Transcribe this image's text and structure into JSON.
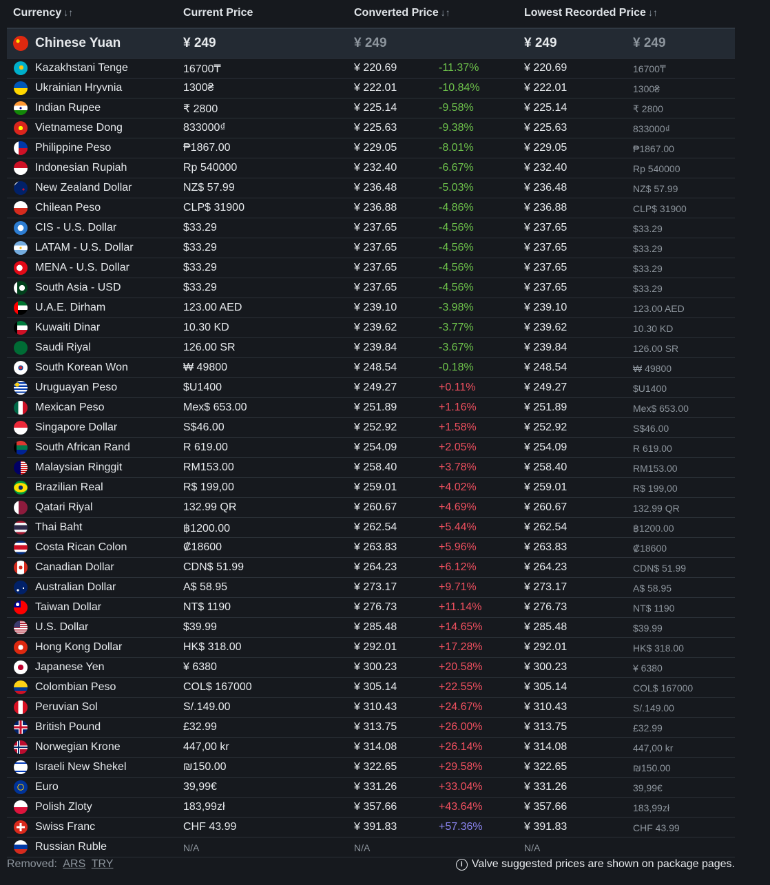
{
  "header": {
    "currency": "Currency",
    "current_price": "Current Price",
    "converted_price": "Converted Price",
    "lowest_price": "Lowest Recorded Price",
    "sort_glyph": "↓↑"
  },
  "base": {
    "name": "Chinese Yuan",
    "current": "¥ 249",
    "converted": "¥ 249",
    "lowest": "¥ 249",
    "lowest_local": "¥ 249",
    "flag": "cn"
  },
  "rows": [
    {
      "name": "Kazakhstani Tenge",
      "current": "16700₸",
      "converted": "¥ 220.69",
      "pct": "-11.37%",
      "lowest": "¥ 220.69",
      "lowest_local": "16700₸",
      "flag": "kz"
    },
    {
      "name": "Ukrainian Hryvnia",
      "current": "1300₴",
      "converted": "¥ 222.01",
      "pct": "-10.84%",
      "lowest": "¥ 222.01",
      "lowest_local": "1300₴",
      "flag": "ua"
    },
    {
      "name": "Indian Rupee",
      "current": "₹ 2800",
      "converted": "¥ 225.14",
      "pct": "-9.58%",
      "lowest": "¥ 225.14",
      "lowest_local": "₹ 2800",
      "flag": "in"
    },
    {
      "name": "Vietnamese Dong",
      "current": "833000₫",
      "converted": "¥ 225.63",
      "pct": "-9.38%",
      "lowest": "¥ 225.63",
      "lowest_local": "833000₫",
      "flag": "vn"
    },
    {
      "name": "Philippine Peso",
      "current": "₱1867.00",
      "converted": "¥ 229.05",
      "pct": "-8.01%",
      "lowest": "¥ 229.05",
      "lowest_local": "₱1867.00",
      "flag": "ph"
    },
    {
      "name": "Indonesian Rupiah",
      "current": "Rp 540000",
      "converted": "¥ 232.40",
      "pct": "-6.67%",
      "lowest": "¥ 232.40",
      "lowest_local": "Rp 540000",
      "flag": "id"
    },
    {
      "name": "New Zealand Dollar",
      "current": "NZ$ 57.99",
      "converted": "¥ 236.48",
      "pct": "-5.03%",
      "lowest": "¥ 236.48",
      "lowest_local": "NZ$ 57.99",
      "flag": "nz"
    },
    {
      "name": "Chilean Peso",
      "current": "CLP$ 31900",
      "converted": "¥ 236.88",
      "pct": "-4.86%",
      "lowest": "¥ 236.88",
      "lowest_local": "CLP$ 31900",
      "flag": "cl"
    },
    {
      "name": "CIS - U.S. Dollar",
      "current": "$33.29",
      "converted": "¥ 237.65",
      "pct": "-4.56%",
      "lowest": "¥ 237.65",
      "lowest_local": "$33.29",
      "flag": "cis"
    },
    {
      "name": "LATAM - U.S. Dollar",
      "current": "$33.29",
      "converted": "¥ 237.65",
      "pct": "-4.56%",
      "lowest": "¥ 237.65",
      "lowest_local": "$33.29",
      "flag": "ar"
    },
    {
      "name": "MENA - U.S. Dollar",
      "current": "$33.29",
      "converted": "¥ 237.65",
      "pct": "-4.56%",
      "lowest": "¥ 237.65",
      "lowest_local": "$33.29",
      "flag": "tr"
    },
    {
      "name": "South Asia - USD",
      "current": "$33.29",
      "converted": "¥ 237.65",
      "pct": "-4.56%",
      "lowest": "¥ 237.65",
      "lowest_local": "$33.29",
      "flag": "pk"
    },
    {
      "name": "U.A.E. Dirham",
      "current": "123.00 AED",
      "converted": "¥ 239.10",
      "pct": "-3.98%",
      "lowest": "¥ 239.10",
      "lowest_local": "123.00 AED",
      "flag": "ae"
    },
    {
      "name": "Kuwaiti Dinar",
      "current": "10.30 KD",
      "converted": "¥ 239.62",
      "pct": "-3.77%",
      "lowest": "¥ 239.62",
      "lowest_local": "10.30 KD",
      "flag": "kw"
    },
    {
      "name": "Saudi Riyal",
      "current": "126.00 SR",
      "converted": "¥ 239.84",
      "pct": "-3.67%",
      "lowest": "¥ 239.84",
      "lowest_local": "126.00 SR",
      "flag": "sa"
    },
    {
      "name": "South Korean Won",
      "current": "₩ 49800",
      "converted": "¥ 248.54",
      "pct": "-0.18%",
      "lowest": "¥ 248.54",
      "lowest_local": "₩ 49800",
      "flag": "kr"
    },
    {
      "name": "Uruguayan Peso",
      "current": "$U1400",
      "converted": "¥ 249.27",
      "pct": "+0.11%",
      "lowest": "¥ 249.27",
      "lowest_local": "$U1400",
      "flag": "uy"
    },
    {
      "name": "Mexican Peso",
      "current": "Mex$ 653.00",
      "converted": "¥ 251.89",
      "pct": "+1.16%",
      "lowest": "¥ 251.89",
      "lowest_local": "Mex$ 653.00",
      "flag": "mx"
    },
    {
      "name": "Singapore Dollar",
      "current": "S$46.00",
      "converted": "¥ 252.92",
      "pct": "+1.58%",
      "lowest": "¥ 252.92",
      "lowest_local": "S$46.00",
      "flag": "sg"
    },
    {
      "name": "South African Rand",
      "current": "R 619.00",
      "converted": "¥ 254.09",
      "pct": "+2.05%",
      "lowest": "¥ 254.09",
      "lowest_local": "R 619.00",
      "flag": "za"
    },
    {
      "name": "Malaysian Ringgit",
      "current": "RM153.00",
      "converted": "¥ 258.40",
      "pct": "+3.78%",
      "lowest": "¥ 258.40",
      "lowest_local": "RM153.00",
      "flag": "my"
    },
    {
      "name": "Brazilian Real",
      "current": "R$ 199,00",
      "converted": "¥ 259.01",
      "pct": "+4.02%",
      "lowest": "¥ 259.01",
      "lowest_local": "R$ 199,00",
      "flag": "br"
    },
    {
      "name": "Qatari Riyal",
      "current": "132.99 QR",
      "converted": "¥ 260.67",
      "pct": "+4.69%",
      "lowest": "¥ 260.67",
      "lowest_local": "132.99 QR",
      "flag": "qa"
    },
    {
      "name": "Thai Baht",
      "current": "฿1200.00",
      "converted": "¥ 262.54",
      "pct": "+5.44%",
      "lowest": "¥ 262.54",
      "lowest_local": "฿1200.00",
      "flag": "th"
    },
    {
      "name": "Costa Rican Colon",
      "current": "₡18600",
      "converted": "¥ 263.83",
      "pct": "+5.96%",
      "lowest": "¥ 263.83",
      "lowest_local": "₡18600",
      "flag": "cr"
    },
    {
      "name": "Canadian Dollar",
      "current": "CDN$ 51.99",
      "converted": "¥ 264.23",
      "pct": "+6.12%",
      "lowest": "¥ 264.23",
      "lowest_local": "CDN$ 51.99",
      "flag": "ca"
    },
    {
      "name": "Australian Dollar",
      "current": "A$ 58.95",
      "converted": "¥ 273.17",
      "pct": "+9.71%",
      "lowest": "¥ 273.17",
      "lowest_local": "A$ 58.95",
      "flag": "au"
    },
    {
      "name": "Taiwan Dollar",
      "current": "NT$ 1190",
      "converted": "¥ 276.73",
      "pct": "+11.14%",
      "lowest": "¥ 276.73",
      "lowest_local": "NT$ 1190",
      "flag": "tw"
    },
    {
      "name": "U.S. Dollar",
      "current": "$39.99",
      "converted": "¥ 285.48",
      "pct": "+14.65%",
      "lowest": "¥ 285.48",
      "lowest_local": "$39.99",
      "flag": "us"
    },
    {
      "name": "Hong Kong Dollar",
      "current": "HK$ 318.00",
      "converted": "¥ 292.01",
      "pct": "+17.28%",
      "lowest": "¥ 292.01",
      "lowest_local": "HK$ 318.00",
      "flag": "hk"
    },
    {
      "name": "Japanese Yen",
      "current": "¥ 6380",
      "converted": "¥ 300.23",
      "pct": "+20.58%",
      "lowest": "¥ 300.23",
      "lowest_local": "¥ 6380",
      "flag": "jp"
    },
    {
      "name": "Colombian Peso",
      "current": "COL$ 167000",
      "converted": "¥ 305.14",
      "pct": "+22.55%",
      "lowest": "¥ 305.14",
      "lowest_local": "COL$ 167000",
      "flag": "co"
    },
    {
      "name": "Peruvian Sol",
      "current": "S/.149.00",
      "converted": "¥ 310.43",
      "pct": "+24.67%",
      "lowest": "¥ 310.43",
      "lowest_local": "S/.149.00",
      "flag": "pe"
    },
    {
      "name": "British Pound",
      "current": "£32.99",
      "converted": "¥ 313.75",
      "pct": "+26.00%",
      "lowest": "¥ 313.75",
      "lowest_local": "£32.99",
      "flag": "gb"
    },
    {
      "name": "Norwegian Krone",
      "current": "447,00 kr",
      "converted": "¥ 314.08",
      "pct": "+26.14%",
      "lowest": "¥ 314.08",
      "lowest_local": "447,00 kr",
      "flag": "no"
    },
    {
      "name": "Israeli New Shekel",
      "current": "₪150.00",
      "converted": "¥ 322.65",
      "pct": "+29.58%",
      "lowest": "¥ 322.65",
      "lowest_local": "₪150.00",
      "flag": "il"
    },
    {
      "name": "Euro",
      "current": "39,99€",
      "converted": "¥ 331.26",
      "pct": "+33.04%",
      "lowest": "¥ 331.26",
      "lowest_local": "39,99€",
      "flag": "eu"
    },
    {
      "name": "Polish Zloty",
      "current": "183,99zł",
      "converted": "¥ 357.66",
      "pct": "+43.64%",
      "lowest": "¥ 357.66",
      "lowest_local": "183,99zł",
      "flag": "pl"
    },
    {
      "name": "Swiss Franc",
      "current": "CHF 43.99",
      "converted": "¥ 391.83",
      "pct": "+57.36%",
      "lowest": "¥ 391.83",
      "lowest_local": "CHF 43.99",
      "flag": "ch"
    },
    {
      "name": "Russian Ruble",
      "current": "N/A",
      "converted": "N/A",
      "pct": "",
      "lowest": "N/A",
      "lowest_local": "",
      "flag": "ru"
    }
  ],
  "footer": {
    "removed_label": "Removed:",
    "removed_links": [
      "ARS",
      "TRY"
    ],
    "note": "Valve suggested prices are shown on package pages.",
    "note_icon": "info-icon"
  },
  "colors": {
    "negative": "#6ec34b",
    "positive": "#f0505f",
    "highest": "#8a84ee"
  }
}
